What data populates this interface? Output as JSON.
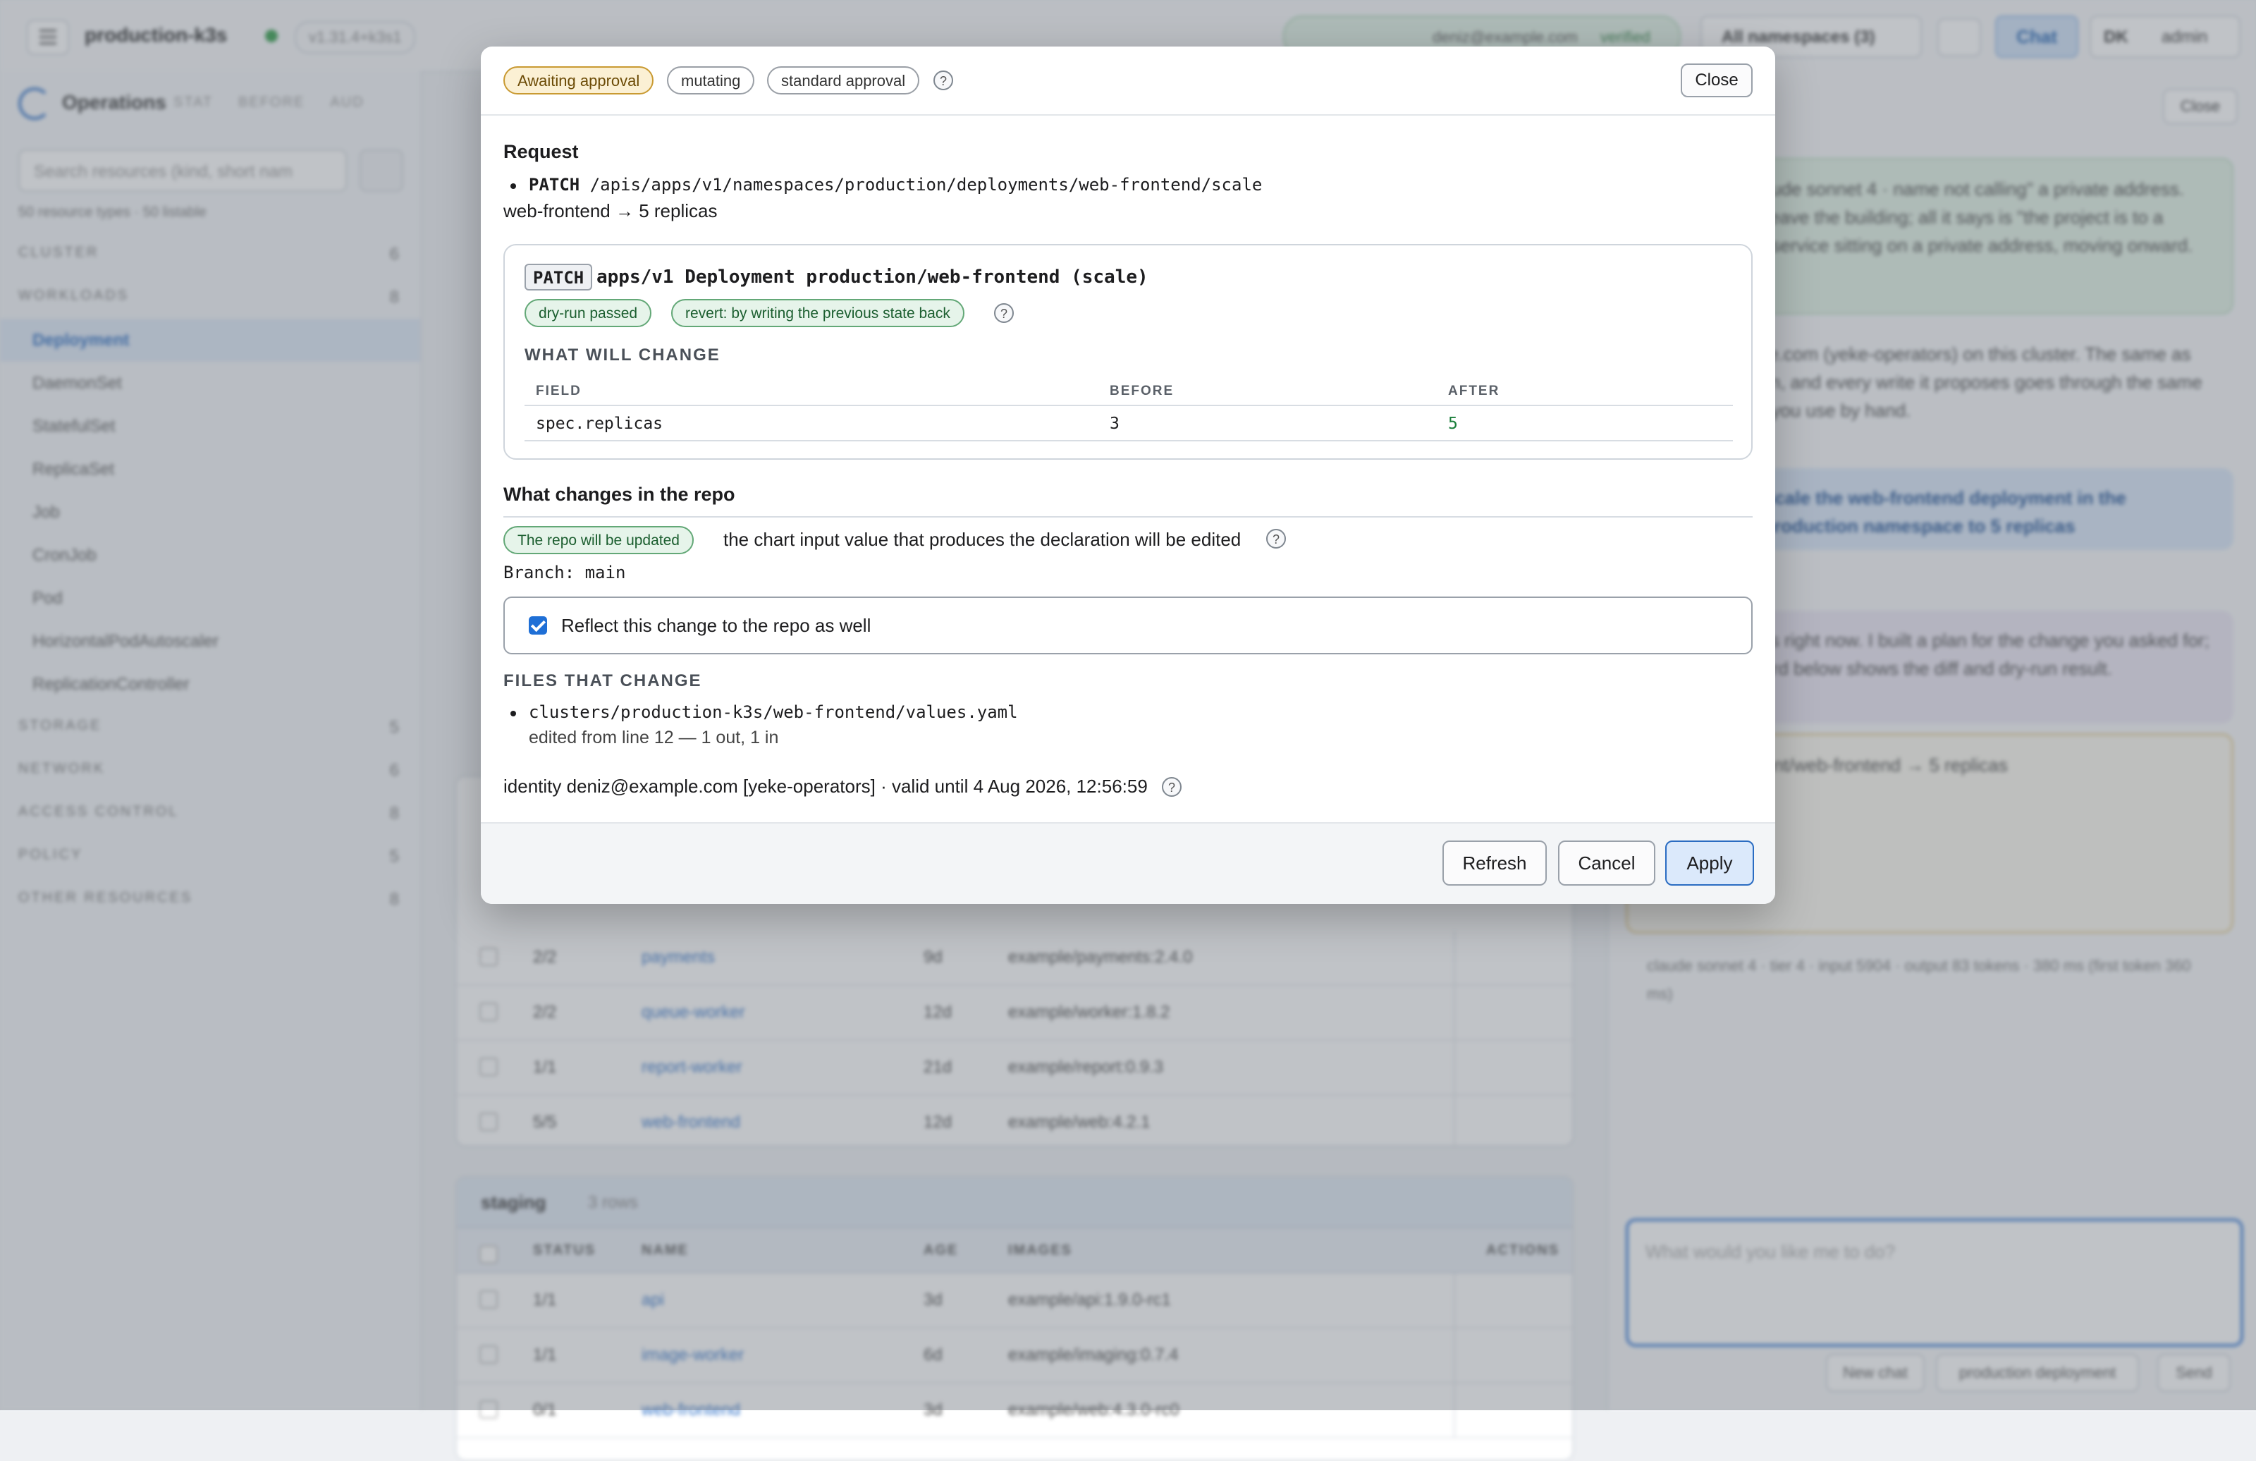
{
  "topbar": {
    "cluster": "production-k3s",
    "version": "v1.31.4+k3s1",
    "identity_user": "deniz@example.com",
    "identity_status": "verified",
    "namespaces": "All namespaces (3)",
    "chat": "Chat",
    "user_initials": "DK",
    "user_role": "admin"
  },
  "sidebar": {
    "title": "Operations",
    "tabs": [
      "STAT",
      "BEFORE",
      "AUD"
    ],
    "search_placeholder": "Search resources (kind, short nam",
    "count": "50 resource types · 50 listable",
    "items": [
      {
        "label": "CLUSTER",
        "count": "6",
        "group": true
      },
      {
        "label": "WORKLOADS",
        "count": "8",
        "group": true
      },
      {
        "label": "Deployment",
        "active": true
      },
      {
        "label": "DaemonSet"
      },
      {
        "label": "StatefulSet"
      },
      {
        "label": "ReplicaSet"
      },
      {
        "label": "Job"
      },
      {
        "label": "CronJob"
      },
      {
        "label": "Pod"
      },
      {
        "label": "HorizontalPodAutoscaler"
      },
      {
        "label": "ReplicationController"
      },
      {
        "label": "STORAGE",
        "count": "5",
        "group": true
      },
      {
        "label": "NETWORK",
        "count": "6",
        "group": true
      },
      {
        "label": "ACCESS CONTROL",
        "count": "8",
        "group": true
      },
      {
        "label": "POLICY",
        "count": "5",
        "group": true
      },
      {
        "label": "OTHER RESOURCES",
        "count": "8",
        "group": true
      }
    ]
  },
  "production_rows": [
    {
      "status": "2/2",
      "name": "payments",
      "age": "9d",
      "image": "example/payments:2.4.0"
    },
    {
      "status": "2/2",
      "name": "queue-worker",
      "age": "12d",
      "image": "example/worker:1.8.2"
    },
    {
      "status": "1/1",
      "name": "report-worker",
      "age": "21d",
      "image": "example/report:0.9.3"
    },
    {
      "status": "5/5",
      "name": "web-frontend",
      "age": "12d",
      "image": "example/web:4.2.1"
    }
  ],
  "staging": {
    "title": "staging",
    "rows_label": "3 rows",
    "columns": [
      "STATUS",
      "NAME",
      "AGE",
      "IMAGES",
      "ACTIONS"
    ],
    "rows": [
      {
        "status": "1/1",
        "name": "api",
        "age": "3d",
        "image": "example/api:1.9.0-rc1"
      },
      {
        "status": "1/1",
        "name": "image-worker",
        "age": "6d",
        "image": "example/imaging:0.7.4"
      },
      {
        "status": "0/1",
        "name": "web-frontend",
        "age": "3d",
        "image": "example/web:4.3.0-rc0"
      }
    ]
  },
  "chatpanel": {
    "close": "Close",
    "green_text": "\"127.0.0.1 · claude sonnet 4 · name not calling\" a private address. That does not leave the building; all it says is \"the project is to a private one\". A service sitting on a private address, moving onward.",
    "plain_text": "deniz@example.com (yeke-operators) on this cluster. The same as your identity can, and every write it proposes goes through the same approval chain you use by hand.",
    "blue_text": "Scale the web-frontend deployment in the production namespace to 5 replicas",
    "purple_text": "It is at 3 replicas right now. I built a plan for the change you asked for; the approval card below shows the diff and dry-run result.",
    "card_text": "apps.deployment/web-frontend → 5 replicas",
    "meta_text": "claude sonnet 4 · tier 4 · input 5904 · output 83 tokens · 380 ms (first token 360 ms)",
    "input_placeholder": "What would you like me to do?",
    "new_chat": "New chat",
    "scope": "production deployment",
    "send": "Send"
  },
  "modal": {
    "badges": {
      "status": "Awaiting approval",
      "kind": "mutating",
      "policy": "standard approval"
    },
    "help": "?",
    "close": "Close",
    "request": {
      "heading": "Request",
      "method": "PATCH",
      "path": "/apis/apps/v1/namespaces/production/deployments/web-frontend/scale",
      "summary": "web-frontend → 5 replicas"
    },
    "patch": {
      "method": "PATCH",
      "title": "apps/v1 Deployment production/web-frontend (scale)",
      "dryrun": "dry-run passed",
      "revert": "revert: by writing the previous state back",
      "what_changes": "WHAT WILL CHANGE",
      "columns": {
        "field": "FIELD",
        "before": "BEFORE",
        "after": "AFTER"
      },
      "row": {
        "field": "spec.replicas",
        "before": "3",
        "after": "5"
      }
    },
    "repo": {
      "heading": "What changes in the repo",
      "badge": "The repo will be updated",
      "desc": "the chart input value that produces the declaration will be edited",
      "branch": "Branch: main",
      "checkbox_label": "Reflect this change to the repo as well",
      "checked": true,
      "files_heading": "FILES THAT CHANGE",
      "file_path": "clusters/production-k3s/web-frontend/values.yaml",
      "file_note": "edited from line 12 — 1 out, 1 in"
    },
    "identity": "identity deniz@example.com [yeke-operators] · valid until 4 Aug 2026, 12:56:59",
    "buttons": {
      "refresh": "Refresh",
      "cancel": "Cancel",
      "apply": "Apply"
    }
  },
  "colors": {
    "accent": "#2a6cc2",
    "pending_badge": "#c99a32",
    "success_badge": "#63a877",
    "after_value": "#1b7f3b"
  }
}
